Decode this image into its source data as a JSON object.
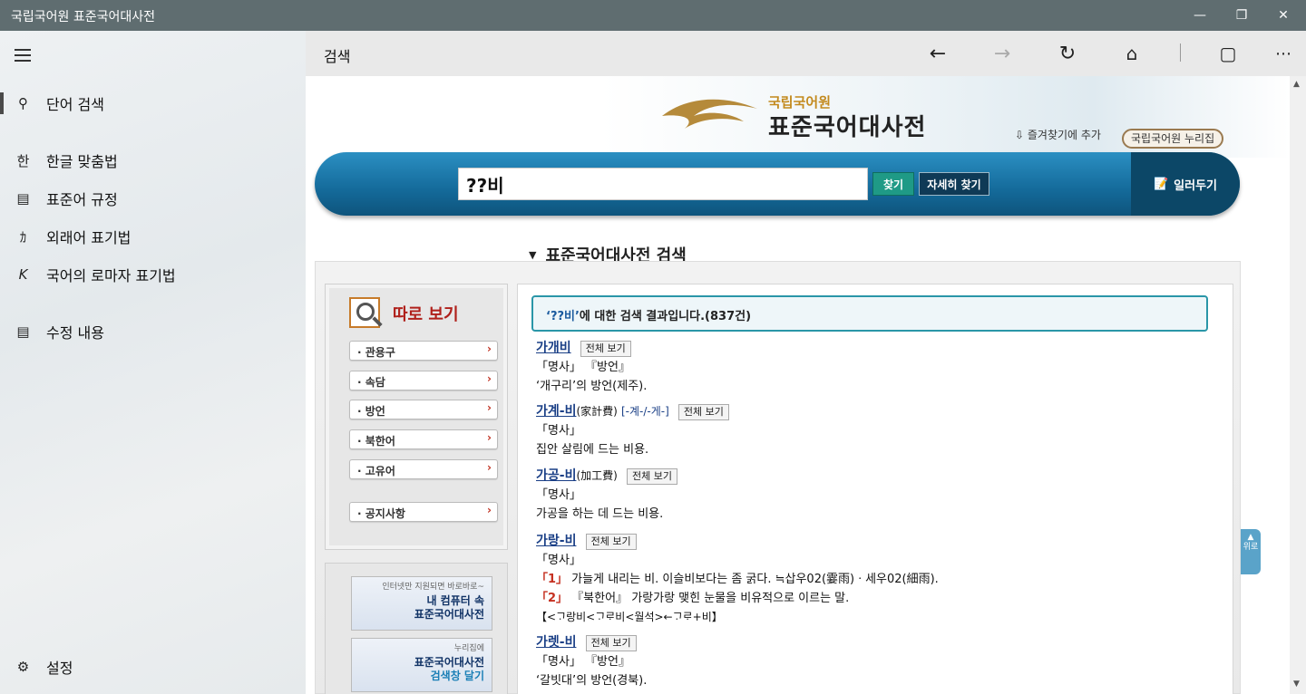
{
  "window": {
    "title": "국립국어원 표준국어대사전"
  },
  "sidebar": {
    "items": [
      {
        "icon": "search-icon",
        "glyph": "⚲",
        "label": "단어 검색",
        "active": true
      },
      {
        "icon": "hangul-icon",
        "glyph": "한",
        "label": "한글 맞춤법"
      },
      {
        "icon": "book-icon",
        "glyph": "▤",
        "label": "표준어 규정"
      },
      {
        "icon": "katakana-icon",
        "glyph": "ｶ",
        "label": "외래어 표기법"
      },
      {
        "icon": "roman-k-icon",
        "glyph": "K",
        "label": "국어의 로마자 표기법"
      },
      {
        "icon": "edit-doc-icon",
        "glyph": "▤",
        "label": "수정 내용"
      }
    ],
    "settings_label": "설정"
  },
  "commandbar": {
    "title": "검색"
  },
  "site": {
    "logo_top": "국립국어원",
    "logo_main": "표준국어대사전",
    "bookmark_label": "즐겨찾기에 추가",
    "nuri_label": "국립국어원 누리집",
    "search_value": "??비",
    "find_label": "찾기",
    "advanced_label": "자세히 찾기",
    "help_label": "일러두기",
    "section_title": "표준국어대사전 검색"
  },
  "leftpanel": {
    "header": "따로 보기",
    "items": [
      "· 관용구",
      "· 속담",
      "· 방언",
      "· 북한어",
      "· 고유어"
    ],
    "notice": "· 공지사항",
    "banner1": {
      "small": "인터넷만 지원되면 바로바로~",
      "line1": "내 컴퓨터 속",
      "line2": "표준국어대사전"
    },
    "banner2": {
      "small": "누리집에",
      "line1": "표준국어대사전",
      "line2": "검색창 달기"
    }
  },
  "results": {
    "header_query": "‘??비’",
    "header_rest": "에 대한 검색 결과입니다.(837건)",
    "full_view": "전체 보기",
    "entries": [
      {
        "word": "가개비",
        "pos": "「명사」 『방언』",
        "def": "‘개구리’의 방언(제주)."
      },
      {
        "word": "가계-비",
        "hanja": "(家計費)",
        "pron": "[-계-/-게-]",
        "pos": "「명사」",
        "def": "집안 살림에 드는 비용."
      },
      {
        "word": "가공-비",
        "hanja": "(加工費)",
        "pos": "「명사」",
        "def": "가공을 하는 데 드는 비용."
      },
      {
        "word": "가랑-비",
        "pos": "「명사」",
        "n1": "「1」",
        "s1": " 가늘게 내리는 비. 이슬비보다는 좀 굵다. ≒삽우02(霎雨)ㆍ세우02(細雨).",
        "n2": "「2」",
        "s2": " 『북한어』 가랑가랑 맺힌 눈물을 비유적으로 이르는 말.",
        "etym": "【<ᄀᆞ랑비<ᄀᆞᄅᆞ비<월석>←ᄀᆞᄅᆞ+비】"
      },
      {
        "word": "가렛-비",
        "pos": "「명사」 『방언』",
        "def": "‘갈빗대’의 방언(경북)."
      }
    ]
  },
  "totop_label": "위로",
  "colors": {
    "titlebar": "#5f6d70",
    "searchbar": "#146a9a",
    "headword": "#1a3f86",
    "accent_red": "#b0201b"
  }
}
